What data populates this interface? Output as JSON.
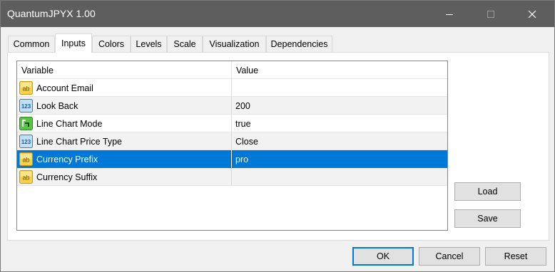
{
  "window": {
    "title": "QuantumJPYX 1.00"
  },
  "tabs": [
    {
      "label": "Common"
    },
    {
      "label": "Inputs"
    },
    {
      "label": "Colors"
    },
    {
      "label": "Levels"
    },
    {
      "label": "Scale"
    },
    {
      "label": "Visualization"
    },
    {
      "label": "Dependencies"
    }
  ],
  "active_tab": "Inputs",
  "grid": {
    "headers": {
      "variable": "Variable",
      "value": "Value"
    },
    "rows": [
      {
        "variable": "Account Email",
        "value": "",
        "icon": "string-ab-icon"
      },
      {
        "variable": "Look Back",
        "value": "200",
        "icon": "integer-123-icon"
      },
      {
        "variable": "Line Chart Mode",
        "value": "true",
        "icon": "boolean-toggle-icon"
      },
      {
        "variable": "Line Chart Price Type",
        "value": "Close",
        "icon": "integer-123-icon"
      },
      {
        "variable": "Currency Prefix",
        "value": "pro",
        "icon": "string-ab-icon",
        "selected": true
      },
      {
        "variable": "Currency Suffix",
        "value": "",
        "icon": "string-ab-icon"
      }
    ]
  },
  "side_buttons": {
    "load": "Load",
    "save": "Save"
  },
  "footer_buttons": {
    "ok": "OK",
    "cancel": "Cancel",
    "reset": "Reset"
  },
  "colors": {
    "title_bar": "#5e5e5e",
    "selection": "#0078d7",
    "default_button_border": "#0078d7"
  }
}
